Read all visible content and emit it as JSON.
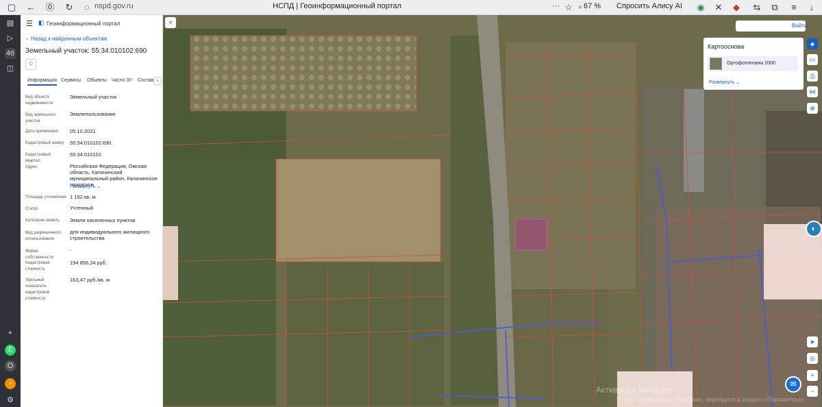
{
  "browser": {
    "url": "nspd.gov.ru",
    "tab_title": "НСПД | Геоинформационный портал",
    "zoom": "67 %",
    "alice": "Спросить Алису AI",
    "more": "···"
  },
  "panel": {
    "portal_name": "Геоинформационный портал",
    "back_link": "Назад к найденным объектам",
    "title": "Земельный участок: 55:34:010102:690",
    "tabs": [
      "Информация",
      "Сервисы",
      "Объекты",
      "Части ЗУ",
      "Состав"
    ],
    "rows": [
      {
        "label": "Вид объекта недвижимости",
        "value": "Земельный участок"
      },
      {
        "label": "Вид земельного участка",
        "value": "Землепользование"
      },
      {
        "label": "Дата присвоения",
        "value": "05.10.2021"
      },
      {
        "label": "Кадастровый номер",
        "value": "55:34:010102:690"
      },
      {
        "label": "Кадастровый квартал",
        "value": "55:34:010102"
      },
      {
        "label": "Адрес",
        "value": "Российская Федерация, Омская область, Калачинский муниципальный район, Калачинское городское"
      },
      {
        "label": "Площадь уточненная",
        "value": "1 192 кв. м"
      },
      {
        "label": "Статус",
        "value": "Учтенный"
      },
      {
        "label": "Категория земель",
        "value": "Земли населенных пунктов"
      },
      {
        "label": "Вид разрешенного использования",
        "value": "для индивидуального жилищного строительства"
      },
      {
        "label": "Форма собственности",
        "value": "-"
      },
      {
        "label": "Кадастровая стоимость",
        "value": "194 856,24 руб."
      },
      {
        "label": "Удельный показатель кадастровой стоимости",
        "value": "163,47 руб./кв. м"
      }
    ],
    "address_expand": "Развернуть"
  },
  "map": {
    "login": "Войти",
    "basemap_title": "Картооснова",
    "basemap_item": "Ортофотопланы 2000",
    "basemap_expand": "Развернуть",
    "watermark": "Активация Windows",
    "watermark_sub": "Чтобы активировать Windows, перейдите в раздел «Параметры».",
    "colors": {
      "parcel": "#c8553a",
      "highlight": "#a1457e",
      "blue_lines": "#4a5cd6"
    }
  }
}
